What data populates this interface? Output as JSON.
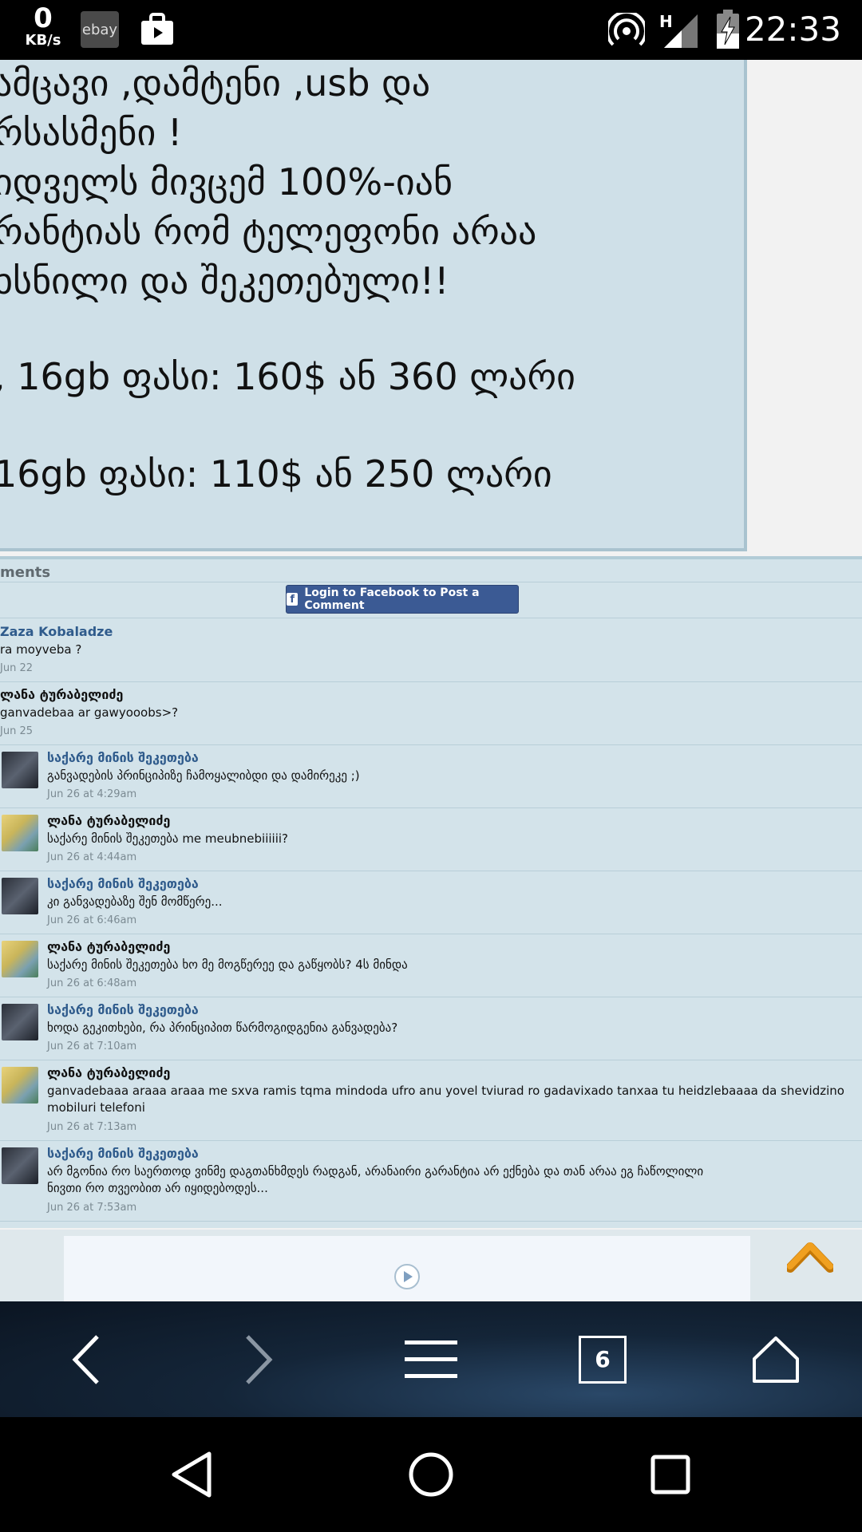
{
  "status_bar": {
    "net_speed_value": "0",
    "net_speed_unit": "KB/s",
    "ebay_label": "ebay",
    "network_type": "H",
    "time": "22:33"
  },
  "post": {
    "lines": [
      "ამცავი ,დამტენი ,usb და",
      "რსასმენი !",
      "იდველს მივცემ 100%-იან",
      "რანტიას რომ ტელეფონი არაა",
      "ხსნილი და შეკეთებული!!",
      ", 16gb ფასი: 160$ ან 360 ლარი",
      "16gb ფასი: 110$ ან 250 ლარი"
    ]
  },
  "comments_section": {
    "title": "ments",
    "login_button_label": "Login to Facebook to Post a Comment",
    "items": [
      {
        "author": "Zaza Kobaladze",
        "text": "ra moyveba ?",
        "time": "Jun 22"
      },
      {
        "author": "ლანა ტურაბელიძე",
        "text": "ganvadebaa ar gawyooobs>?",
        "time": "Jun 25"
      },
      {
        "author": "საქარე მინის შეკეთება",
        "text": "განვადების პრინციპიზე ჩამოყალიბდი და დამირეკე ;)",
        "time": "Jun 26 at 4:29am"
      },
      {
        "author": "ლანა ტურაბელიძე",
        "text": "საქარე მინის შეკეთება me meubnebiiiiii?",
        "time": "Jun 26 at 4:44am"
      },
      {
        "author": "საქარე მინის შეკეთება",
        "text": "კი განვადებაზე შენ მომწერე...",
        "time": "Jun 26 at 6:46am"
      },
      {
        "author": "ლანა ტურაბელიძე",
        "text": "საქარე მინის შეკეთება ხო მე მოგწერეე და გაწყობს? 4ს მინდა",
        "time": "Jun 26 at 6:48am"
      },
      {
        "author": "საქარე მინის შეკეთება",
        "text": "ხოდა გეკითხები, რა პრინციპით წარმოგიდგენია განვადება?",
        "time": "Jun 26 at 7:10am"
      },
      {
        "author": "ლანა ტურაბელიძე",
        "text_line1": "ganvadebaaa araaa araaa me sxva ramis tqma mindoda ufro anu yovel tviurad ro gadavixado tanxaa tu heidzlebaaaa da shevidzino",
        "text_line2": "mobiluri telefoni",
        "time": "Jun 26 at 7:13am"
      },
      {
        "author": "საქარე მინის შეკეთება",
        "text_line1": "არ მგონია რო საერთოდ ვინმე დაგთანხმდეს რადგან, არანაირი გარანტია არ ექნება და თან არაა ეგ ჩაწოლილი",
        "text_line2": "ნივთი რო თვეობით არ იყიდებოდეს...",
        "time": "Jun 26 at 7:53am"
      }
    ]
  },
  "browser": {
    "tab_count": "6"
  },
  "colors": {
    "post_bg": "#cfe0e8",
    "comments_bg": "#d3e3ea",
    "author_blue": "#2f5b8c",
    "fb_blue": "#3b5a94",
    "scroll_top_orange": "#f0a020"
  }
}
